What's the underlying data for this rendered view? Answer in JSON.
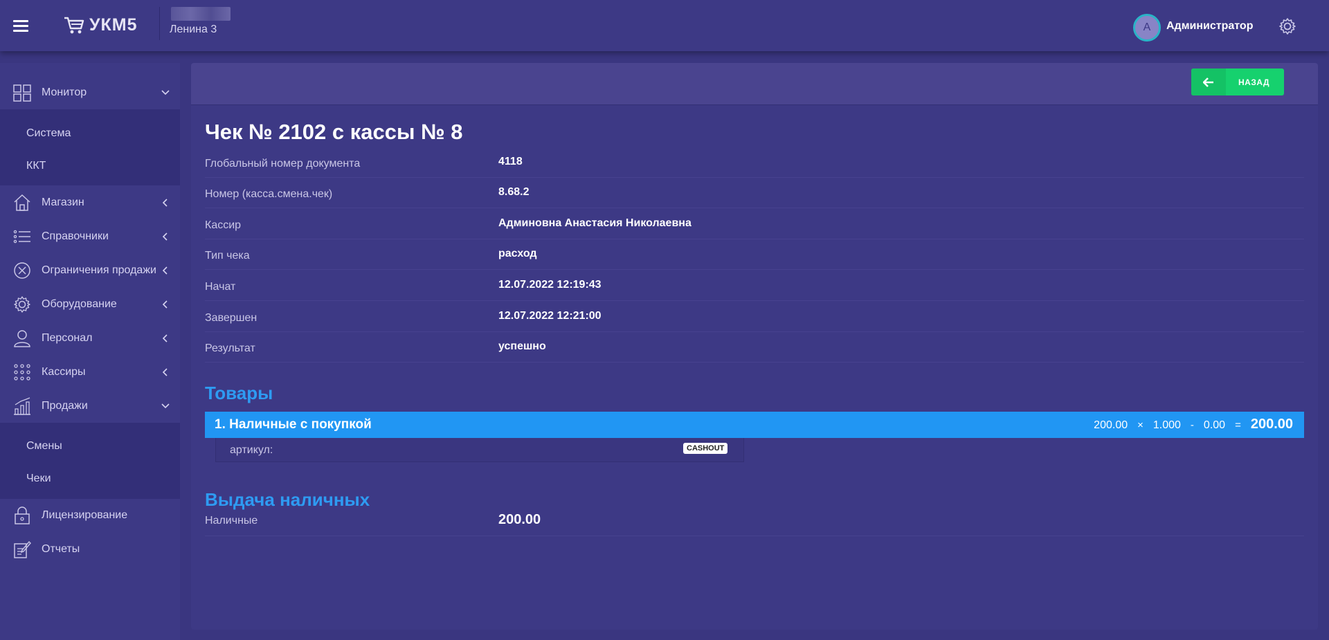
{
  "header": {
    "app_name": "УКМ5",
    "store_name": "Ленина 3",
    "user_initial": "A",
    "user_name": "Администратор"
  },
  "sidebar": {
    "items": [
      {
        "label": "Монитор",
        "icon": "monitor-grid-icon",
        "expanded": true
      },
      {
        "label": "Магазин",
        "icon": "store-icon",
        "expanded": false
      },
      {
        "label": "Справочники",
        "icon": "list-icon",
        "expanded": false
      },
      {
        "label": "Ограничения продажи",
        "icon": "circle-x-icon",
        "expanded": false
      },
      {
        "label": "Оборудование",
        "icon": "gear-icon",
        "expanded": false
      },
      {
        "label": "Персонал",
        "icon": "user-icon",
        "expanded": false
      },
      {
        "label": "Кассиры",
        "icon": "dots-grid-icon",
        "expanded": false
      },
      {
        "label": "Продажи",
        "icon": "bar-chart-icon",
        "expanded": true
      },
      {
        "label": "Лицензирование",
        "icon": "lock-icon"
      },
      {
        "label": "Отчеты",
        "icon": "report-edit-icon"
      }
    ],
    "monitor_sub": [
      "Система",
      "ККТ"
    ],
    "sales_sub": [
      "Смены",
      "Чеки"
    ]
  },
  "toolbar": {
    "back_label": "НАЗАД"
  },
  "receipt": {
    "title": "Чек № 2102 с кассы № 8",
    "rows": [
      {
        "label": "Глобальный номер документа",
        "value": "4118"
      },
      {
        "label": "Номер (касса.смена.чек)",
        "value": "8.68.2"
      },
      {
        "label": "Кассир",
        "value": "Админовна Анастасия Николаевна"
      },
      {
        "label": "Тип чека",
        "value": "расход"
      },
      {
        "label": "Начат",
        "value": "12.07.2022 12:19:43"
      },
      {
        "label": "Завершен",
        "value": "12.07.2022 12:21:00"
      },
      {
        "label": "Результат",
        "value": "успешно"
      }
    ]
  },
  "goods": {
    "section_title": "Товары",
    "item": {
      "name": "1. Наличные с покупкой",
      "price": "200.00",
      "times": "×",
      "qty": "1.000",
      "minus": "-",
      "discount": "0.00",
      "equals": "=",
      "total": "200.00",
      "sku_label": "артикул:",
      "badge": "CASHOUT"
    }
  },
  "cashout": {
    "section_title": "Выдача наличных",
    "label": "Наличные",
    "value": "200.00"
  },
  "colors": {
    "background": "#3a3680",
    "panel": "#3d3985",
    "accent_blue": "#2196f3",
    "button_green": "#16d16e"
  }
}
